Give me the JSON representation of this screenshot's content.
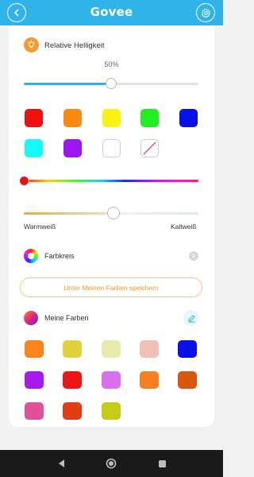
{
  "app": {
    "title": "Govee"
  },
  "brightness": {
    "label": "Relative Helligkeit",
    "value_text": "50%",
    "value": 0.5
  },
  "colors": {
    "row1": [
      "#ee1111",
      "#fb8a13",
      "#fbf212",
      "#22ee22",
      "#0a11e6"
    ],
    "row2": [
      "#15f9f9",
      "#9b16f0",
      "#ffffff",
      "none"
    ]
  },
  "hue_slider": {
    "position": 0.0
  },
  "temperature": {
    "warm_label": "Warmweiß",
    "cold_label": "Kaltweiß",
    "value": 0.5
  },
  "color_wheel": {
    "label": "Farbkreis"
  },
  "save_button": {
    "label": "Unter Meinen Farben speichern"
  },
  "my_colors": {
    "label": "Meine Farben",
    "swatches": [
      "#f8851b",
      "#e2d13d",
      "#e8ecaa",
      "#f1c1b8",
      "#0a11e6",
      "#a61af0",
      "#ef1515",
      "#d970f0",
      "#f7811f",
      "#d9560d",
      "#e35097",
      "#e23d14",
      "#c5cc18"
    ]
  }
}
